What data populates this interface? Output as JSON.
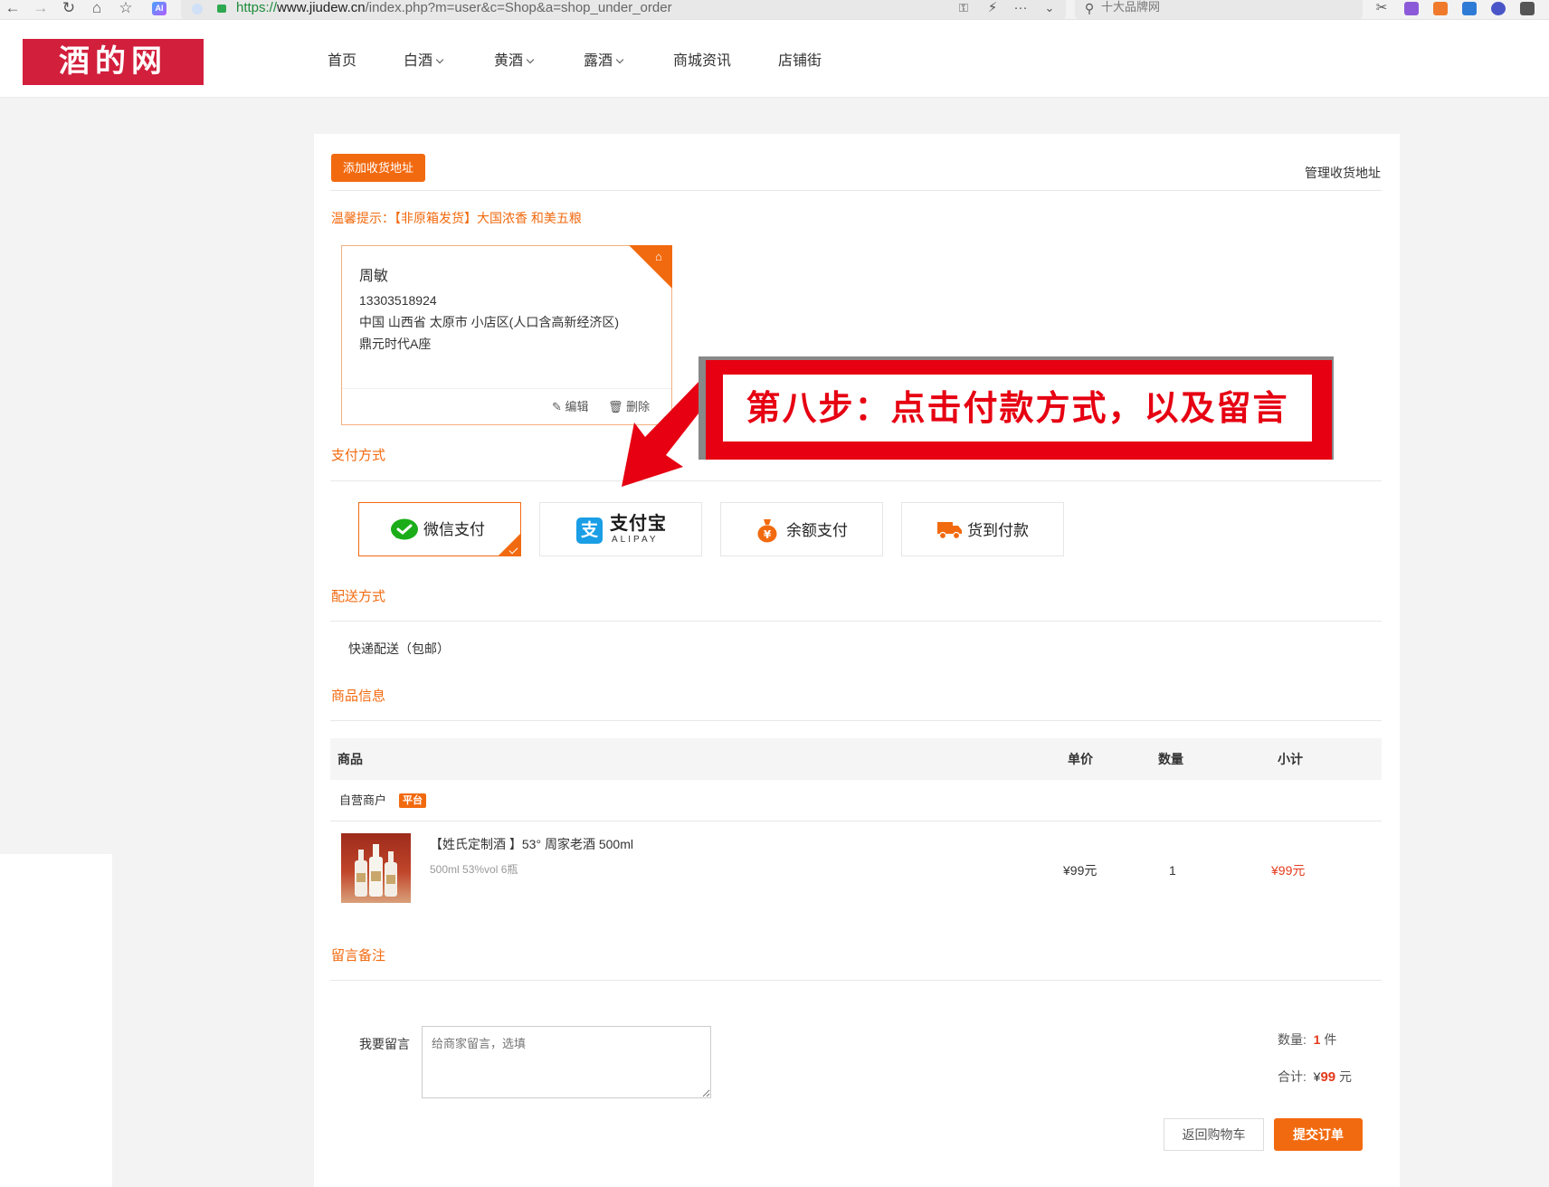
{
  "browser": {
    "url_scheme": "https://",
    "url_domain": "www.jiudew.cn",
    "url_path": "/index.php?m=user&c=Shop&a=shop_under_order",
    "search_text": "十大品牌网"
  },
  "site": {
    "logo_text": "酒的网",
    "nav": [
      {
        "label": "首页",
        "dropdown": false
      },
      {
        "label": "白酒",
        "dropdown": true
      },
      {
        "label": "黄酒",
        "dropdown": true
      },
      {
        "label": "露酒",
        "dropdown": true
      },
      {
        "label": "商城资讯",
        "dropdown": false
      },
      {
        "label": "店铺街",
        "dropdown": false
      }
    ]
  },
  "address": {
    "add_button": "添加收货地址",
    "manage_link": "管理收货地址",
    "tip": "温馨提示：【非原箱发货】大国浓香 和美五粮",
    "card": {
      "name": "周敏",
      "phone": "13303518924",
      "region": "中国 山西省 太原市 小店区(人口含高新经济区)",
      "detail": "鼎元时代A座",
      "edit": "编辑",
      "delete": "删除"
    }
  },
  "payment": {
    "title": "支付方式",
    "options": [
      {
        "label": "微信支付",
        "icon": "wechat-icon",
        "selected": true
      },
      {
        "label": "支付宝",
        "sublabel": "ALIPAY",
        "icon": "alipay-icon",
        "selected": false
      },
      {
        "label": "余额支付",
        "icon": "money-bag-icon",
        "selected": false
      },
      {
        "label": "货到付款",
        "icon": "truck-icon",
        "selected": false
      }
    ]
  },
  "delivery": {
    "title": "配送方式",
    "method": "快递配送（包邮）"
  },
  "goods": {
    "title": "商品信息",
    "headers": {
      "product": "商品",
      "price": "单价",
      "qty": "数量",
      "subtotal": "小计"
    },
    "merchant": "自营商户",
    "merchant_badge": "平台",
    "items": [
      {
        "name": "【姓氏定制酒 】53° 周家老酒 500ml",
        "spec": "500ml  53%vol  6瓶",
        "price": "¥99元",
        "qty": "1",
        "subtotal": "¥99元"
      }
    ]
  },
  "remark": {
    "title": "留言备注",
    "label": "我要留言",
    "placeholder": "给商家留言，选填"
  },
  "summary": {
    "qty_label": "数量:",
    "qty_value": "1",
    "qty_unit": "件",
    "total_label": "合计:",
    "currency": "¥",
    "total_value": "99",
    "total_unit": "元",
    "back_button": "返回购物车",
    "submit_button": "提交订单"
  },
  "annotation": {
    "text": "第八步：点击付款方式，以及留言"
  },
  "colors": {
    "accent": "#f26a0f",
    "logo_bg": "#d21f3c",
    "annotation_red": "#e60012",
    "wechat_green": "#1aad19",
    "alipay_blue": "#1a9ee6"
  }
}
